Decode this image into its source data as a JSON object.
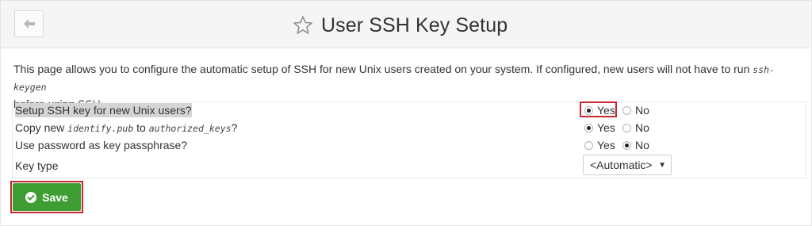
{
  "header": {
    "title": "User SSH Key Setup",
    "back_icon": "arrow-left-icon",
    "star_icon": "star-icon"
  },
  "intro": {
    "text_1": "This page allows you to configure the automatic setup of SSH for new Unix users created on your system. If configured, new users will not have to run ",
    "command": "ssh-keygen",
    "text_2": "before using SSH."
  },
  "form": {
    "rows": [
      {
        "label": "Setup SSH key for new Unix users?",
        "yes": "Yes",
        "no": "No",
        "selected": "Yes"
      },
      {
        "label_pre": "Copy new ",
        "label_code1": "identify.pub",
        "label_mid": " to ",
        "label_code2": "authorized_keys",
        "label_post": "?",
        "yes": "Yes",
        "no": "No",
        "selected": "Yes"
      },
      {
        "label": "Use password as key passphrase?",
        "yes": "Yes",
        "no": "No",
        "selected": "No"
      },
      {
        "label": "Key type",
        "value": "<Automatic>"
      }
    ]
  },
  "actions": {
    "save_label": "Save",
    "save_icon": "check-circle-icon"
  },
  "colors": {
    "save_green": "#3e9d33",
    "highlight_red": "#c9272e"
  }
}
